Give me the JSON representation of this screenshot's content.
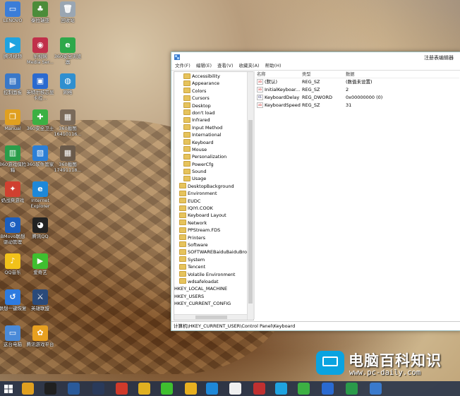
{
  "desktop": {
    "icons": [
      {
        "label": "LENOVO",
        "color": "#3b7dd8",
        "glyph": "▭"
      },
      {
        "label": "泰拉瑞亚",
        "color": "#4c8c3a",
        "glyph": "♣"
      },
      {
        "label": "回收站",
        "color": "#9aa6b2",
        "glyph": "🗑"
      },
      {
        "label": "腾讯视频",
        "color": "#1fa3e0",
        "glyph": "▶"
      },
      {
        "label": "乐视网 Media Ser...",
        "color": "#c0304a",
        "glyph": "◉"
      },
      {
        "label": "360安全浏览器",
        "color": "#2ea84a",
        "glyph": "e"
      },
      {
        "label": "控制面板",
        "color": "#3a78c8",
        "glyph": "▤"
      },
      {
        "label": "英特尔核芯显卡控...",
        "color": "#2a6ad0",
        "glyph": "▣"
      },
      {
        "label": "网络",
        "color": "#2f8fd0",
        "glyph": "◍"
      },
      {
        "label": "Manual",
        "color": "#e0a020",
        "glyph": "❐"
      },
      {
        "label": "360安全卫士",
        "color": "#3cb043",
        "glyph": "✚"
      },
      {
        "label": "360截图 16410116...",
        "color": "#7a6a5a",
        "glyph": "▦"
      },
      {
        "label": "360游戏保险箱",
        "color": "#2a9d4a",
        "glyph": "▥"
      },
      {
        "label": "360软件管家",
        "color": "#2c7fd6",
        "glyph": "▧"
      },
      {
        "label": "360截图 17491118...",
        "color": "#6a5a4a",
        "glyph": "▦"
      },
      {
        "label": "奶战爽游戏",
        "color": "#d04030",
        "glyph": "✦"
      },
      {
        "label": "Internet Explorer",
        "color": "#1e88d8",
        "glyph": "e"
      },
      {
        "label": "BMovo联想驱动管理",
        "color": "#1c5fbf",
        "glyph": "⚙"
      },
      {
        "label": "腾讯QQ",
        "color": "#222222",
        "glyph": "◕"
      },
      {
        "label": "QQ音乐",
        "color": "#f2c21a",
        "glyph": "♪"
      },
      {
        "label": "爱奇艺",
        "color": "#3fbf2f",
        "glyph": "▶"
      },
      {
        "label": "联想一键恢复",
        "color": "#2d7be0",
        "glyph": "↺"
      },
      {
        "label": "英雄联盟",
        "color": "#2a4a7a",
        "glyph": "⚔"
      },
      {
        "label": "这台电脑",
        "color": "#4a8ad8",
        "glyph": "▭"
      },
      {
        "label": "腾讯游戏平台",
        "color": "#e8a020",
        "glyph": "✿"
      }
    ]
  },
  "window": {
    "title": "注册表编辑器",
    "menu": [
      "文件(F)",
      "编辑(E)",
      "查看(V)",
      "收藏夹(A)",
      "帮助(H)"
    ],
    "tree": [
      {
        "label": "Accessibility",
        "depth": 2,
        "folder": true
      },
      {
        "label": "Appearance",
        "depth": 2,
        "folder": true
      },
      {
        "label": "Colors",
        "depth": 2,
        "folder": true
      },
      {
        "label": "Cursors",
        "depth": 2,
        "folder": true
      },
      {
        "label": "Desktop",
        "depth": 2,
        "folder": true
      },
      {
        "label": "don't load",
        "depth": 2,
        "folder": true
      },
      {
        "label": "Infrared",
        "depth": 2,
        "folder": true
      },
      {
        "label": "Input Method",
        "depth": 2,
        "folder": true
      },
      {
        "label": "International",
        "depth": 2,
        "folder": true
      },
      {
        "label": "Keyboard",
        "depth": 2,
        "folder": true
      },
      {
        "label": "Mouse",
        "depth": 2,
        "folder": true
      },
      {
        "label": "Personalization",
        "depth": 2,
        "folder": true
      },
      {
        "label": "PowerCfg",
        "depth": 2,
        "folder": true
      },
      {
        "label": "Sound",
        "depth": 2,
        "folder": true
      },
      {
        "label": "Usage",
        "depth": 2,
        "folder": true
      },
      {
        "label": "DesktopBackground",
        "depth": 1,
        "folder": true
      },
      {
        "label": "Environment",
        "depth": 1,
        "folder": true
      },
      {
        "label": "EUDC",
        "depth": 1,
        "folder": true
      },
      {
        "label": "IQIYI.COOK",
        "depth": 1,
        "folder": true
      },
      {
        "label": "Keyboard Layout",
        "depth": 1,
        "folder": true
      },
      {
        "label": "Network",
        "depth": 1,
        "folder": true
      },
      {
        "label": "PPStream.FDS",
        "depth": 1,
        "folder": true
      },
      {
        "label": "Printers",
        "depth": 1,
        "folder": true
      },
      {
        "label": "Software",
        "depth": 1,
        "folder": true
      },
      {
        "label": "SOFTWAREBaiduBaiduBrowser",
        "depth": 1,
        "folder": true
      },
      {
        "label": "System",
        "depth": 1,
        "folder": true
      },
      {
        "label": "Tencent",
        "depth": 1,
        "folder": true
      },
      {
        "label": "Volatile Environment",
        "depth": 1,
        "folder": true
      },
      {
        "label": "wdsafeloadat",
        "depth": 1,
        "folder": true
      },
      {
        "label": "HKEY_LOCAL_MACHINE",
        "depth": 0,
        "folder": false
      },
      {
        "label": "HKEY_USERS",
        "depth": 0,
        "folder": false
      },
      {
        "label": "HKEY_CURRENT_CONFIG",
        "depth": 0,
        "folder": false
      }
    ],
    "columns": {
      "name": "名称",
      "type": "类型",
      "data": "数据"
    },
    "rows": [
      {
        "name": "(默认)",
        "type": "REG_SZ",
        "data": "(数值未设置)",
        "kind": "sz"
      },
      {
        "name": "InitialKeyboar...",
        "type": "REG_SZ",
        "data": "2",
        "kind": "sz"
      },
      {
        "name": "KeyboardDelay",
        "type": "REG_DWORD",
        "data": "0x00000000 (0)",
        "kind": "dword"
      },
      {
        "name": "KeyboardSpeed",
        "type": "REG_SZ",
        "data": "31",
        "kind": "sz"
      }
    ],
    "status": "计算机\\HKEY_CURRENT_USER\\Control Panel\\Keyboard"
  },
  "watermark": {
    "title": "电脑百科知识",
    "url": "www.pc-daily.com"
  },
  "taskbar": {
    "items": [
      {
        "name": "start",
        "color": "#ffffff"
      },
      {
        "name": "app-2345",
        "color": "#e0a020"
      },
      {
        "name": "app-qq",
        "color": "#202020"
      },
      {
        "name": "app-mx",
        "color": "#2a5a9a"
      },
      {
        "name": "app-league",
        "color": "#2a3a5a"
      },
      {
        "name": "app-chrome",
        "color": "#d03a2a"
      },
      {
        "name": "app-circle",
        "color": "#e0b020"
      },
      {
        "name": "app-iqiyi",
        "color": "#3fbf2f"
      },
      {
        "name": "app-yellow",
        "color": "#e8b020"
      },
      {
        "name": "app-ie",
        "color": "#1e88d8"
      },
      {
        "name": "app-file",
        "color": "#f0f0f0"
      },
      {
        "name": "app-red",
        "color": "#c03030"
      },
      {
        "name": "app-video",
        "color": "#1fa3e0"
      },
      {
        "name": "app-360",
        "color": "#3cb043"
      },
      {
        "name": "app-blue",
        "color": "#2a6ad0"
      },
      {
        "name": "app-qqmusic",
        "color": "#2a9a4a"
      },
      {
        "name": "app-regedit",
        "color": "#3a7acc"
      }
    ]
  }
}
